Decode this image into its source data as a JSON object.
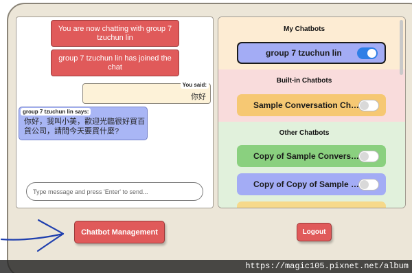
{
  "chat": {
    "system_messages": [
      "You are now chatting with group 7 tzuchun lin",
      "group 7 tzuchun lin has joined the chat"
    ],
    "user_message": {
      "label": "You said:",
      "text": "你好"
    },
    "bot_message": {
      "label": "group 7 tzuchun lin says:",
      "text": "你好，我叫小美，歡迎光臨很好買百貨公司，請問今天要買什麼?"
    },
    "input": {
      "value": "",
      "placeholder": "Type message and press 'Enter' to send..."
    }
  },
  "chatbots": {
    "my": {
      "title": "My Chatbots",
      "items": [
        {
          "name": "group 7 tzuchun lin",
          "enabled": true
        }
      ]
    },
    "builtin": {
      "title": "Built-in Chatbots",
      "items": [
        {
          "name": "Sample Conversation Chatbot",
          "enabled": false
        }
      ]
    },
    "other": {
      "title": "Other Chatbots",
      "items": [
        {
          "name": "Copy of Sample Conversation Chatbot",
          "enabled": false
        },
        {
          "name": "Copy of Copy of Sample Conversation Chatbot",
          "enabled": false
        }
      ]
    }
  },
  "buttons": {
    "management": "Chatbot Management",
    "logout": "Logout"
  },
  "watermark": {
    "url": "https://magic105.pixnet.net/album"
  },
  "colors": {
    "accent_red": "#e05a5a",
    "bot_bubble": "#a9b6f5",
    "toggle_on": "#2f7fe6",
    "annotation_arrow": "#1f3fae"
  }
}
